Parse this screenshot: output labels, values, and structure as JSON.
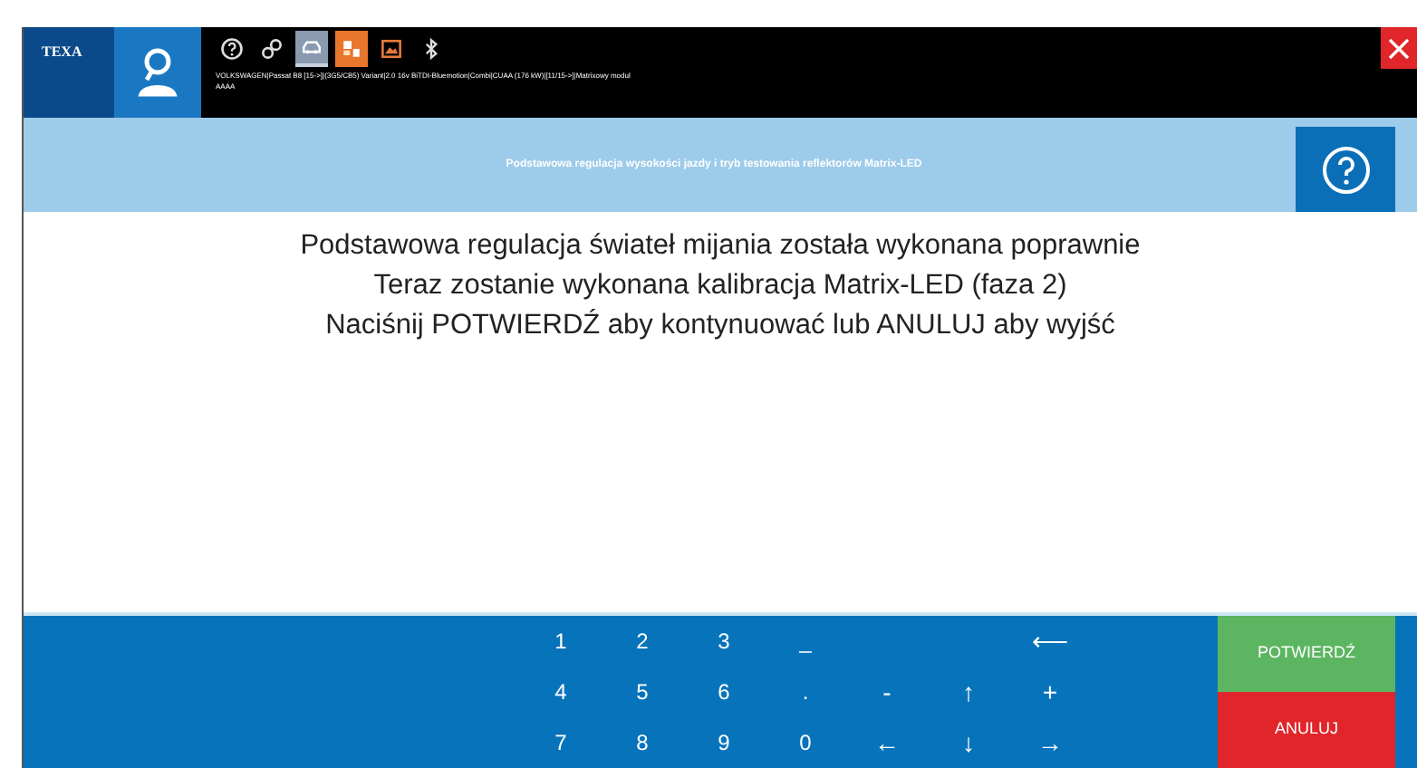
{
  "brand": "TEXA",
  "toolbar": {
    "vehicle": "VOLKSWAGEN|Passat B8 [15->]|(3G5/CB5) Variant|2.0 16v BiTDI-Bluemotion|Combi|CUAA (176 kW)|[11/15->]|Matrixowy modul",
    "vehicle_line_2": "AAAA",
    "tabs": [
      {
        "selected": false,
        "highlighted": false
      },
      {
        "selected": false,
        "highlighted": false
      },
      {
        "selected": false,
        "highlighted": true
      },
      {
        "selected": true,
        "highlighted": false
      },
      {
        "selected": false,
        "highlighted": false
      },
      {
        "selected": false,
        "highlighted": false
      }
    ]
  },
  "header": {
    "title": "Podstawowa regulacja wysokości jazdy i tryb testowania reflektorów Matrix-LED"
  },
  "message": [
    "Podstawowa regulacja świateł mijania została wykonana poprawnie",
    "Teraz zostanie wykonana kalibracja Matrix-LED (faza 2)",
    "Naciśnij POTWIERDŹ aby kontynuować lub ANULUJ aby wyjść"
  ],
  "keypad": [
    {
      "digits": [
        "1",
        "2",
        "3",
        "_"
      ],
      "arrows": [
        "⟵"
      ]
    },
    {
      "digits": [
        "4",
        "5",
        "6",
        "."
      ],
      "arrows": [
        "-",
        "↑",
        "+"
      ]
    },
    {
      "digits": [
        "7",
        "8",
        "9",
        "0"
      ],
      "arrows": [
        "←",
        "↓",
        "→"
      ]
    }
  ],
  "buttons": [
    {
      "label": "POTWIERDŹ",
      "kind": "confirm"
    },
    {
      "label": "ANULUJ",
      "kind": "cancel"
    }
  ]
}
